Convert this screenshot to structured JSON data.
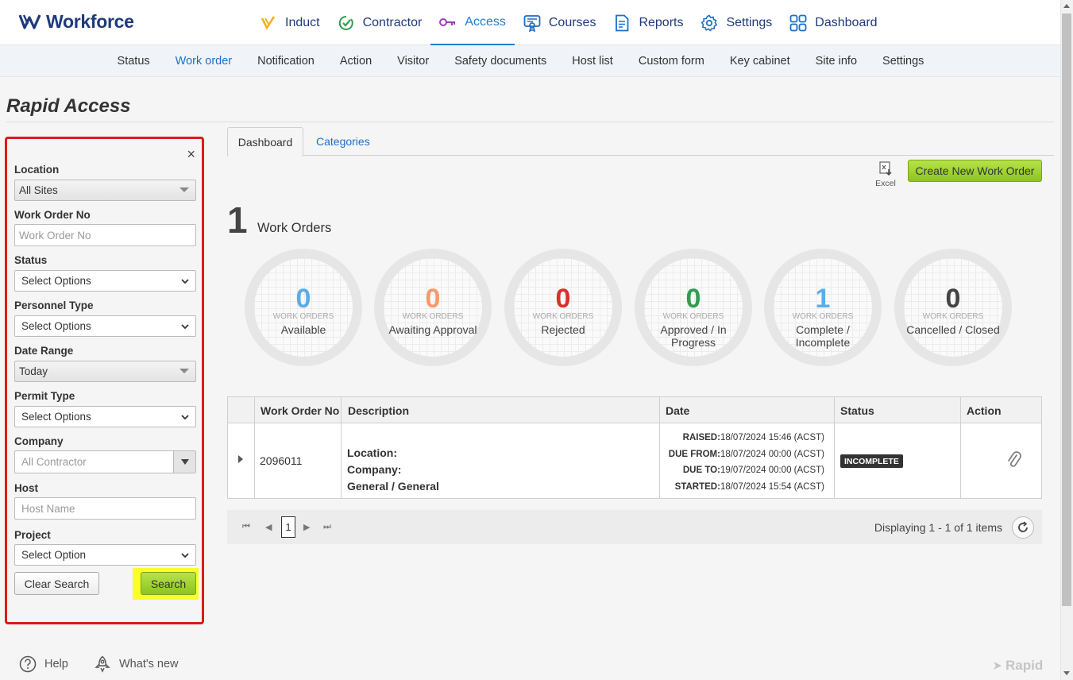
{
  "brand": {
    "name": "Workforce",
    "accent": "#1d7ed6",
    "navy": "#1f3a7a"
  },
  "mainnav": [
    {
      "label": "Induct",
      "icon": "induct-icon"
    },
    {
      "label": "Contractor",
      "icon": "contractor-icon"
    },
    {
      "label": "Access",
      "icon": "key-icon",
      "active": true
    },
    {
      "label": "Courses",
      "icon": "certificate-icon"
    },
    {
      "label": "Reports",
      "icon": "report-icon"
    },
    {
      "label": "Settings",
      "icon": "gear-icon"
    },
    {
      "label": "Dashboard",
      "icon": "grid-icon"
    }
  ],
  "subnav": [
    "Status",
    "Work order",
    "Notification",
    "Action",
    "Visitor",
    "Safety documents",
    "Host list",
    "Custom form",
    "Key cabinet",
    "Site info",
    "Settings"
  ],
  "page": {
    "title": "Rapid Access"
  },
  "filters": {
    "close": "×",
    "location_label": "Location",
    "location_value": "All Sites",
    "work_order_label": "Work Order No",
    "work_order_placeholder": "Work Order No",
    "status_label": "Status",
    "status_value": "Select Options",
    "personnel_label": "Personnel Type",
    "personnel_value": "Select Options",
    "date_label": "Date Range",
    "date_value": "Today",
    "permit_label": "Permit Type",
    "permit_value": "Select Options",
    "company_label": "Company",
    "company_placeholder": "All Contractor",
    "host_label": "Host",
    "host_placeholder": "Host Name",
    "project_label": "Project",
    "project_value": "Select Option",
    "clear_label": "Clear Search",
    "search_label": "Search"
  },
  "tabs": {
    "dashboard": "Dashboard",
    "categories": "Categories"
  },
  "toolbar": {
    "excel_label": "Excel",
    "create_label": "Create New Work Order"
  },
  "summary": {
    "count": "1",
    "label": "Work Orders"
  },
  "circles": [
    {
      "count": "0",
      "small": "WORK ORDERS",
      "label": "Available",
      "color": "#5aaee8"
    },
    {
      "count": "0",
      "small": "WORK ORDERS",
      "label": "Awaiting Approval",
      "color": "#f59a6a"
    },
    {
      "count": "0",
      "small": "WORK ORDERS",
      "label": "Rejected",
      "color": "#d9302c"
    },
    {
      "count": "0",
      "small": "WORK ORDERS",
      "label": "Approved / In Progress",
      "color": "#2e9e4f"
    },
    {
      "count": "1",
      "small": "WORK ORDERS",
      "label": "Complete / Incomplete",
      "color": "#5aaee8"
    },
    {
      "count": "0",
      "small": "WORK ORDERS",
      "label": "Cancelled / Closed",
      "color": "#444444"
    }
  ],
  "table": {
    "headers": [
      "Work Order No",
      "Description",
      "Date",
      "Status",
      "Action"
    ],
    "rows": [
      {
        "work_order": "2096011",
        "desc_location": "Location:",
        "desc_company": "Company:",
        "desc_category": "General / General",
        "raised_label": "RAISED:",
        "raised": "18/07/2024 15:46 (ACST)",
        "due_from_label": "DUE FROM:",
        "due_from": "18/07/2024 00:00 (ACST)",
        "due_to_label": "DUE TO:",
        "due_to": "19/07/2024 00:00 (ACST)",
        "started_label": "STARTED:",
        "started": "18/07/2024 15:54 (ACST)",
        "status": "INCOMPLETE"
      }
    ]
  },
  "pager": {
    "page": "1",
    "info": "Displaying 1 - 1 of 1 items"
  },
  "footer": {
    "help": "Help",
    "whats_new": "What's new",
    "brand": "Rapid"
  }
}
